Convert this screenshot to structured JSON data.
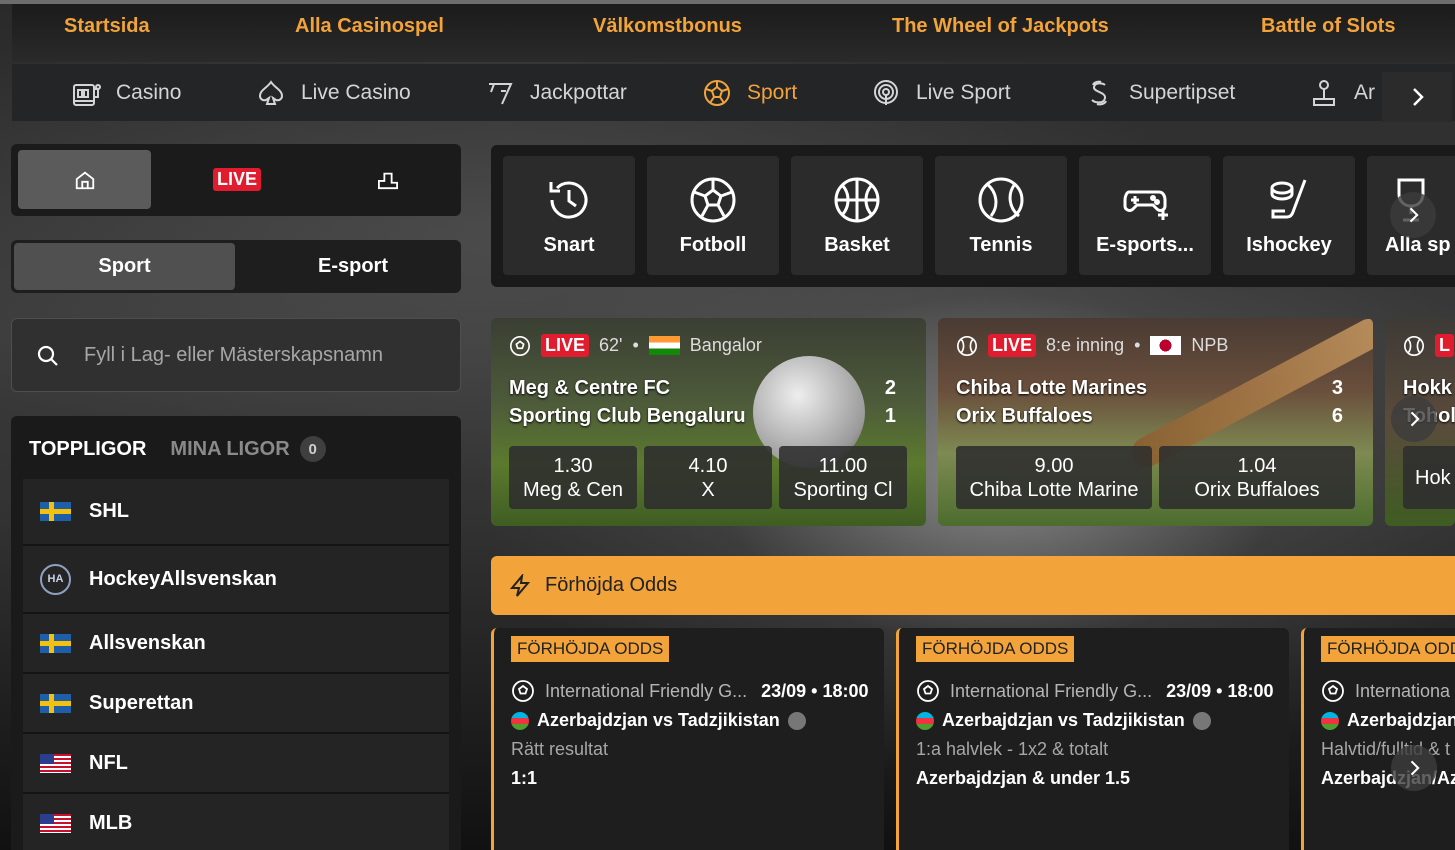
{
  "promo_nav": [
    "Startsida",
    "Alla Casinospel",
    "Välkomstbonus",
    "The Wheel of Jackpots",
    "Battle of Slots"
  ],
  "category_nav": [
    {
      "label": "Casino",
      "icon": "slot-machine-icon"
    },
    {
      "label": "Live Casino",
      "icon": "spade-icon"
    },
    {
      "label": "Jackpottar",
      "icon": "seven-icon"
    },
    {
      "label": "Sport",
      "icon": "football-icon",
      "active": true
    },
    {
      "label": "Live Sport",
      "icon": "broadcast-icon"
    },
    {
      "label": "Supertipset",
      "icon": "supertipset-icon"
    },
    {
      "label": "Ar",
      "icon": "joystick-icon"
    }
  ],
  "mode_bar": {
    "live_label": "LIVE"
  },
  "sport_toggle": {
    "sport": "Sport",
    "esport": "E-sport"
  },
  "search": {
    "placeholder": "Fyll i Lag- eller Mästerskapsnamn"
  },
  "leagues": {
    "tab_top": "TOPPLIGOR",
    "tab_mine": "MINA LIGOR",
    "mine_count": "0",
    "items": [
      {
        "name": "SHL",
        "flag": "se"
      },
      {
        "name": "HockeyAllsvenskan",
        "flag": "ha"
      },
      {
        "name": "Allsvenskan",
        "flag": "se"
      },
      {
        "name": "Superettan",
        "flag": "se"
      },
      {
        "name": "NFL",
        "flag": "us"
      },
      {
        "name": "MLB",
        "flag": "us"
      }
    ]
  },
  "sports": [
    {
      "label": "Snart",
      "icon": "history-icon"
    },
    {
      "label": "Fotboll",
      "icon": "football-icon"
    },
    {
      "label": "Basket",
      "icon": "basketball-icon"
    },
    {
      "label": "Tennis",
      "icon": "tennis-icon"
    },
    {
      "label": "E-sports...",
      "icon": "gamepad-icon"
    },
    {
      "label": "Ishockey",
      "icon": "hockey-icon"
    },
    {
      "label": "Alla sp",
      "icon": "trophy-icon"
    }
  ],
  "live_matches": [
    {
      "live": "LIVE",
      "time": "62'",
      "league": "Bangalor",
      "home": "Meg & Centre FC",
      "home_score": "2",
      "away": "Sporting Club Bengaluru",
      "away_score": "1",
      "odds": [
        {
          "value": "1.30",
          "label": "Meg & Cen"
        },
        {
          "value": "4.10",
          "label": "X"
        },
        {
          "value": "11.00",
          "label": "Sporting Cl"
        }
      ]
    },
    {
      "live": "LIVE",
      "time": "8:e inning",
      "league": "NPB",
      "home": "Chiba Lotte Marines",
      "home_score": "3",
      "away": "Orix Buffaloes",
      "away_score": "6",
      "odds": [
        {
          "value": "9.00",
          "label": "Chiba Lotte Marine"
        },
        {
          "value": "1.04",
          "label": "Orix Buffaloes"
        }
      ]
    },
    {
      "live": "L",
      "home": "Hokk",
      "away": "Tohol",
      "odds": [
        {
          "label": "Hok"
        }
      ]
    }
  ],
  "boosted": {
    "title": "Förhöjda Odds",
    "cards": [
      {
        "tag": "FÖRHÖJDA ODDS",
        "competition": "International Friendly G...",
        "when": "23/09 • 18:00",
        "match": "Azerbajdzjan vs Tadzjikistan",
        "market": "Rätt resultat",
        "selection": "1:1"
      },
      {
        "tag": "FÖRHÖJDA ODDS",
        "competition": "International Friendly G...",
        "when": "23/09 • 18:00",
        "match": "Azerbajdzjan vs Tadzjikistan",
        "market": "1:a halvlek - 1x2 & totalt",
        "selection": "Azerbajdzjan & under 1.5"
      },
      {
        "tag": "FÖRHÖJDA ODDS",
        "competition": "Internationa",
        "when": "",
        "match": "Azerbajdzjan v",
        "market": "Halvtid/fulltid & t",
        "selection": "Azerbajdzjan/Az"
      }
    ]
  },
  "colors": {
    "accent": "#f2a33a",
    "live": "#e11c2e"
  }
}
